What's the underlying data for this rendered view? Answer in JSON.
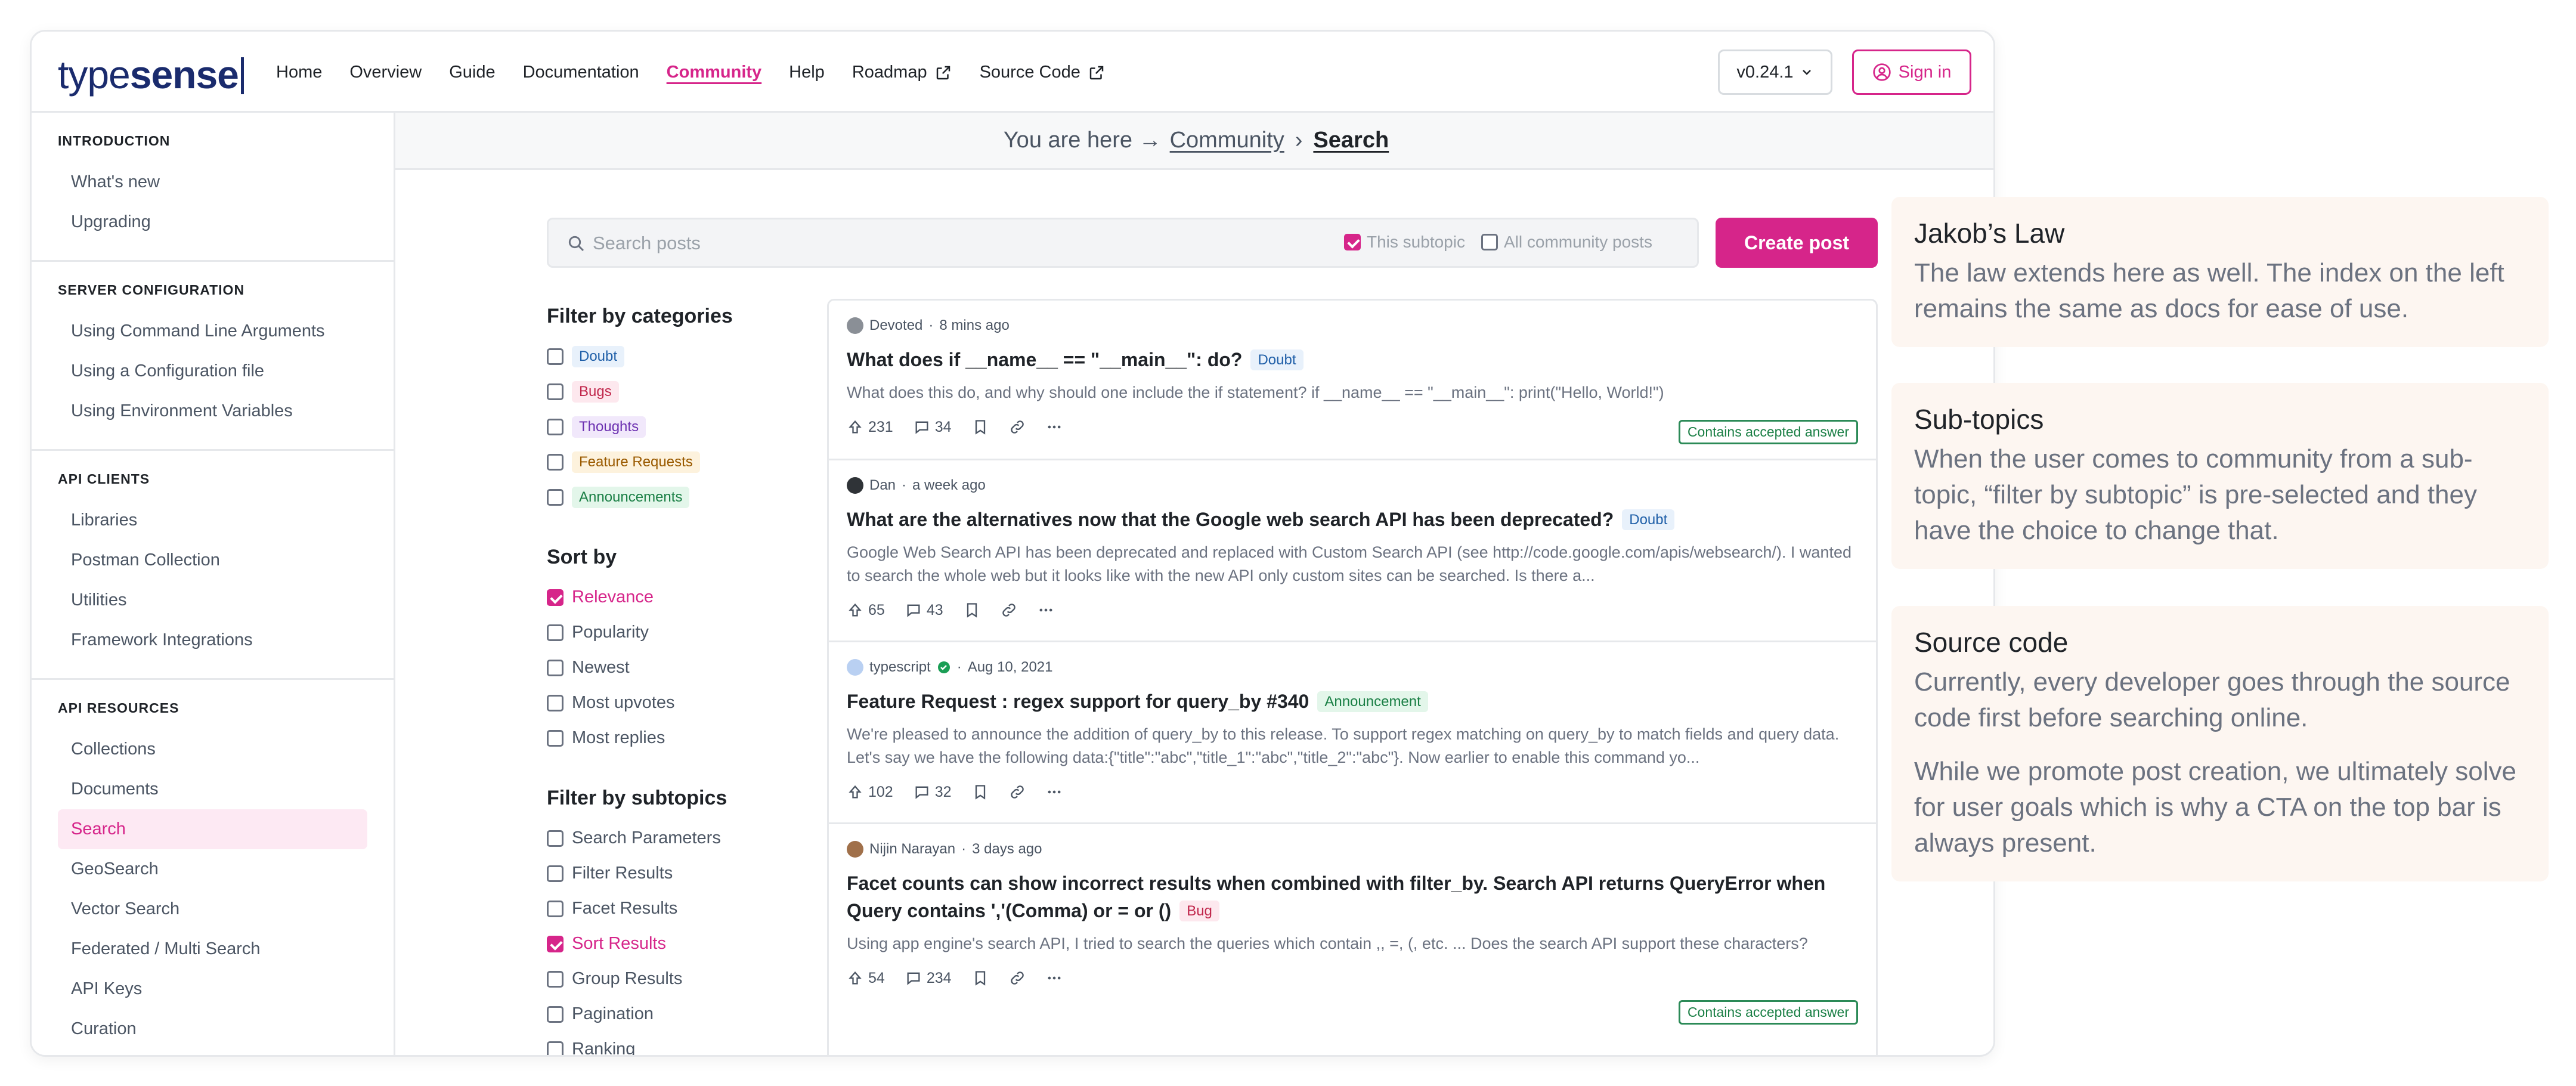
{
  "brand": {
    "logo_part1": "type",
    "logo_part2": "sense"
  },
  "nav": {
    "links": [
      "Home",
      "Overview",
      "Guide",
      "Documentation",
      "Community",
      "Help",
      "Roadmap",
      "Source Code"
    ],
    "active": "Community",
    "version": "v0.24.1",
    "signin": "Sign in"
  },
  "sidebar": {
    "sections": [
      {
        "heading": "INTRODUCTION",
        "items": [
          "What's new",
          "Upgrading"
        ]
      },
      {
        "heading": "SERVER CONFIGURATION",
        "items": [
          "Using Command Line Arguments",
          "Using a Configuration file",
          "Using Environment Variables"
        ]
      },
      {
        "heading": "API CLIENTS",
        "items": [
          "Libraries",
          "Postman Collection",
          "Utilities",
          "Framework Integrations"
        ]
      },
      {
        "heading": "API RESOURCES",
        "items": [
          "Collections",
          "Documents",
          "Search",
          "GeoSearch",
          "Vector Search",
          "Federated / Multi Search",
          "API Keys",
          "Curation"
        ]
      }
    ],
    "active_item": "Search"
  },
  "breadcrumb": {
    "prefix": "You are here →",
    "community": "Community",
    "separator": "›",
    "current": "Search"
  },
  "search": {
    "placeholder": "Search posts",
    "value": "",
    "scope_subtopic": "This subtopic",
    "scope_all": "All community posts",
    "create_label": "Create post"
  },
  "filters": {
    "categories_title": "Filter by categories",
    "categories": [
      "Doubt",
      "Bugs",
      "Thoughts",
      "Feature Requests",
      "Announcements"
    ],
    "sort_title": "Sort by",
    "sort_options": [
      "Relevance",
      "Popularity",
      "Newest",
      "Most upvotes",
      "Most replies"
    ],
    "sort_selected": "Relevance",
    "subtopics_title": "Filter by subtopics",
    "subtopics": [
      "Search Parameters",
      "Filter Results",
      "Facet Results",
      "Sort Results",
      "Group Results",
      "Pagination",
      "Ranking"
    ],
    "subtopic_selected": "Sort Results"
  },
  "posts": [
    {
      "author": "Devoted",
      "time": "8 mins ago",
      "title": "What does if __name__ == \"__main__\": do?",
      "tag": "Doubt",
      "body": "What does this do, and why should one include the if statement?  if __name__ == \"__main__\":     print(\"Hello, World!\")",
      "upvotes": "231",
      "replies": "34",
      "accepted": "Contains accepted answer"
    },
    {
      "author": "Dan",
      "time": "a week ago",
      "title": "What are the alternatives now that the Google web search API has been deprecated?",
      "tag": "Doubt",
      "body": "Google Web Search API has been deprecated and replaced with Custom Search API (see http://code.google.com/apis/websearch/).  I wanted to search the whole web but it looks like with the new API only custom sites can be searched.  Is there a...",
      "upvotes": "65",
      "replies": "43",
      "accepted": ""
    },
    {
      "author": "typescript",
      "time": "Aug 10, 2021",
      "title": "Feature Request : regex support for query_by #340",
      "tag": "Announcement",
      "body": "We're pleased to announce the addition of query_by to this release. To support regex matching on query_by to match fields and query data. Let's say we have the following data:{\"title\":\"abc\",\"title_1\":\"abc\",\"title_2\":\"abc\"}. Now earlier to enable this command yo...",
      "upvotes": "102",
      "replies": "32",
      "accepted": ""
    },
    {
      "author": "Nijin Narayan",
      "time": "3 days ago",
      "title": "Facet counts can show incorrect results when combined with filter_by. Search API returns QueryError when Query contains ','(Comma) or = or ()",
      "tag": "Bug",
      "body": "Using app engine's search API, I tried to search the queries which contain ,, =, (, etc. ... Does the search API support these characters?",
      "upvotes": "54",
      "replies": "234",
      "accepted": "Contains accepted answer"
    }
  ],
  "notes": [
    {
      "title": "Jakob’s Law",
      "paragraphs": [
        "The law extends here as well. The index on the left remains the same as docs for ease of use."
      ]
    },
    {
      "title": "Sub-topics",
      "paragraphs": [
        "When the user comes to community from a sub-topic, “filter by subtopic” is pre-selected and they have the choice to change that."
      ]
    },
    {
      "title": "Source code",
      "paragraphs": [
        "Currently, every developer goes through the source code first before searching online.",
        "While we promote post creation, we ultimately solve for user goals which is why a CTA on the top bar is always present."
      ]
    }
  ],
  "colors": {
    "accent": "#d6258a",
    "brand": "#1a2b6d",
    "accepted": "#1a7f45"
  }
}
